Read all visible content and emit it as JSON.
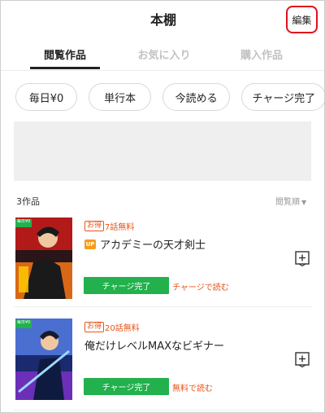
{
  "header": {
    "title": "本棚",
    "edit_label": "編集"
  },
  "tabs": [
    {
      "label": "閲覧作品",
      "active": true
    },
    {
      "label": "お気に入り",
      "active": false
    },
    {
      "label": "購入作品",
      "active": false
    }
  ],
  "filters": [
    "毎日¥0",
    "単行本",
    "今読める",
    "チャージ完了",
    "ー"
  ],
  "list": {
    "count": "3作品",
    "sort_label": "閲覧順"
  },
  "books": [
    {
      "tag": "お得",
      "free_label": "7話無料",
      "badge": "UP",
      "title": "アカデミーの天才剣士",
      "status_button": "チャージ完了",
      "action_link": "チャージで読む",
      "cover_badge": "毎日¥0"
    },
    {
      "tag": "お得",
      "free_label": "20話無料",
      "title": "俺だけレベルMAXなビギナー",
      "status_button": "チャージ完了",
      "action_link": "無料で読む",
      "cover_badge": "毎日¥0"
    }
  ],
  "colors": {
    "accent": "#e8541a",
    "charge_green": "#22b14c",
    "highlight": "#e0121e",
    "up_badge": "#f59c1a"
  }
}
